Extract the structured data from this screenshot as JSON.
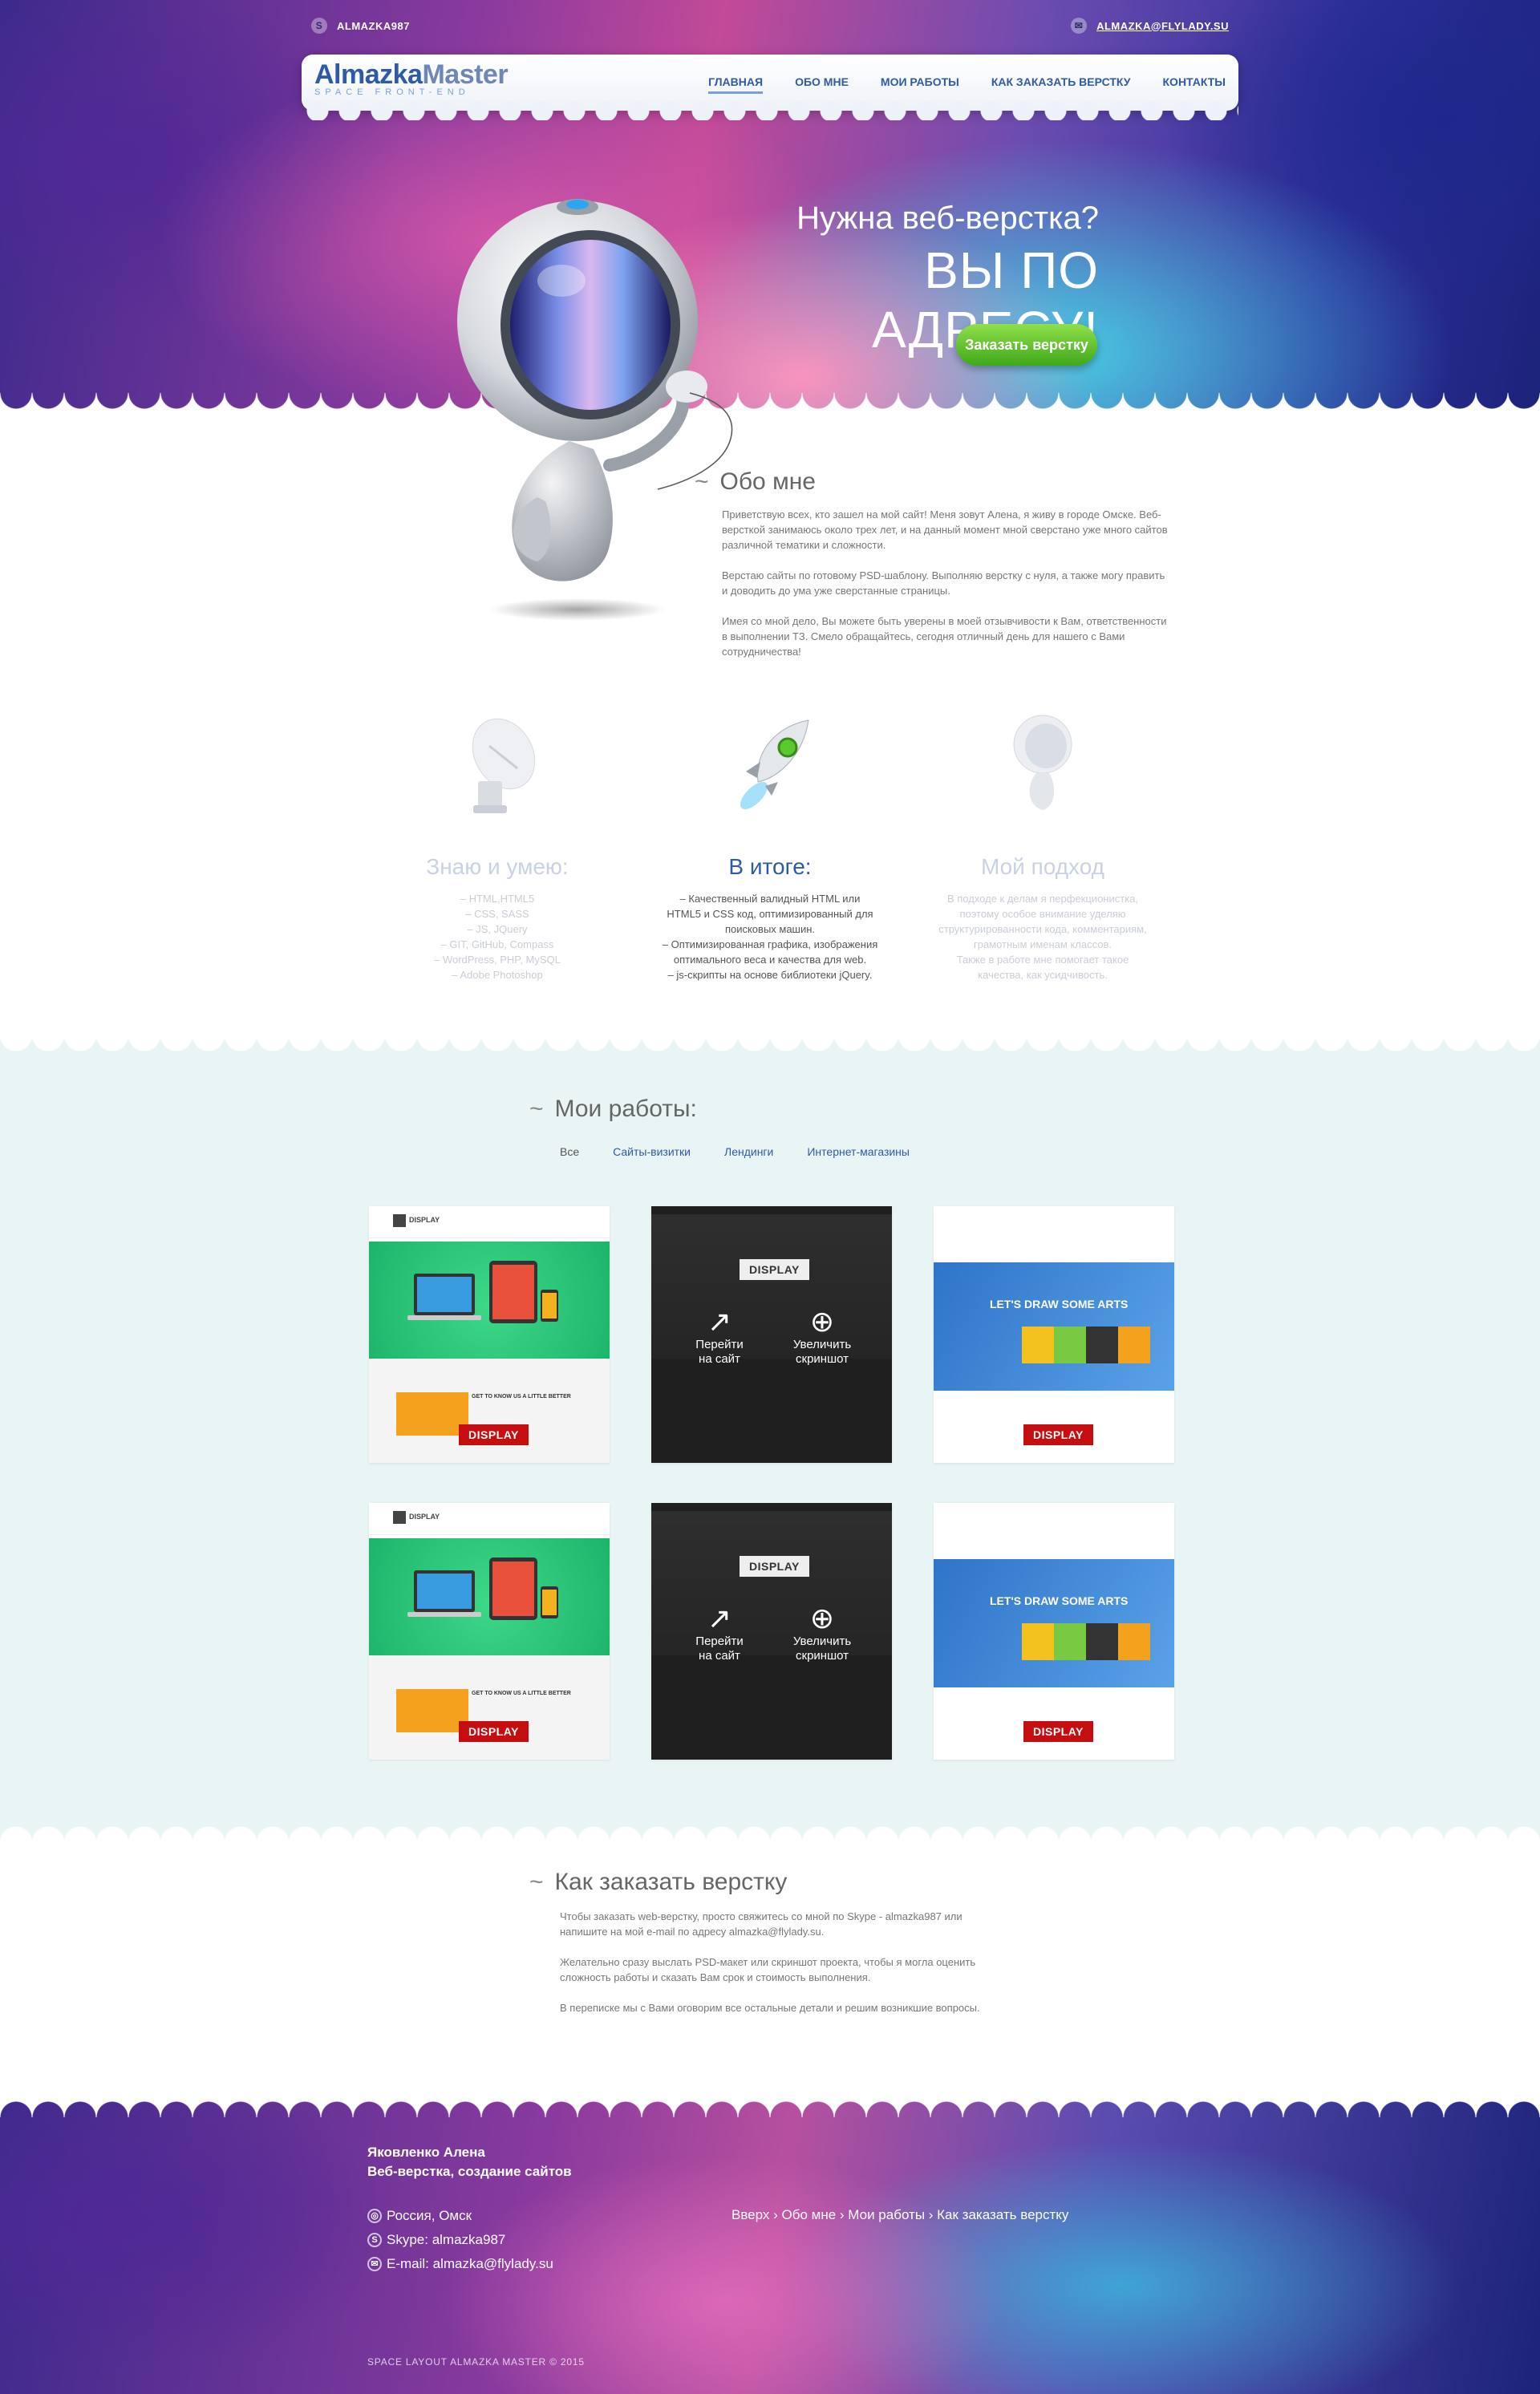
{
  "topbar": {
    "skype": "ALMAZKA987",
    "email": "ALMAZKA@FLYLADY.SU"
  },
  "logo": {
    "part1": "Almazka",
    "part2": "Master",
    "tagline": "SPACE FRONT-END"
  },
  "nav": [
    "ГЛАВНАЯ",
    "ОБО МНЕ",
    "МОИ РАБОТЫ",
    "КАК ЗАКАЗАТЬ ВЕРСТКУ",
    "КОНТАКТЫ"
  ],
  "hero": {
    "line1": "Нужна веб-верстка?",
    "line2": "ВЫ ПО АДРЕСУ!",
    "button": "Заказать верстку"
  },
  "about": {
    "title": "Обо мне",
    "paragraphs": [
      "Приветствую всех, кто зашел на мой сайт! Меня зовут Алена, я живу в городе Омске. Веб-версткой занимаюсь около трех лет, и на данный момент мной сверстано уже много сайтов различной тематики и сложности.",
      "Верстаю сайты по готовому PSD-шаблону. Выполняю верстку с нуля, а также могу править и доводить до ума уже сверстанные страницы.",
      "Имея со мной дело, Вы можете быть уверены в моей отзывчивости к Вам, ответственности в выполнении ТЗ. Смело обращайтесь, сегодня отличный день для нашего с Вами сотрудничества!"
    ]
  },
  "features": [
    {
      "title": "Знаю и умею:",
      "lines": [
        "– HTML,HTML5",
        "– CSS, SASS",
        "– JS, JQuery",
        "– GIT, GitHub, Compass",
        "– WordPress, PHP, MySQL",
        "– Adobe Photoshop"
      ]
    },
    {
      "title": "В итоге:",
      "lines": [
        "– Качественный валидный HTML или",
        "HTML5 и CSS код, оптимизированный для",
        "поисковых машин.",
        "– Оптимизированная графика, изображения",
        "оптимального веса и качества для web.",
        "– js-скрипты на основе библиотеки jQuery."
      ]
    },
    {
      "title": "Мой подход",
      "lines": [
        "В подходе к делам я перфекционистка,",
        "поэтому особое внимание уделяю",
        "структурированности кода, комментариям,",
        "грамотным именам классов.",
        "Также в работе мне помогает такое",
        "качества, как усидчивость."
      ]
    }
  ],
  "works": {
    "title": "Мои работы:",
    "filters": [
      "Все",
      "Сайты-визитки",
      "Лендинги",
      "Интернет-магазины"
    ],
    "badge": "DISPLAY",
    "goto": [
      "Перейти",
      "на сайт"
    ],
    "zoom": [
      "Увеличить",
      "скриншот"
    ],
    "blue_heading": "LET'S DRAW SOME ARTS",
    "green_tagline": "GET TO KNOW US A LITTLE BETTER"
  },
  "order": {
    "title": "Как заказать верстку",
    "paragraphs": [
      "Чтобы заказать web-верстку, просто свяжитесь со мной по Skype - almazka987 или напишите на мой e-mail по адресу almazka@flylady.su.",
      "Желательно сразу выслать PSD-макет или скриншот проекта, чтобы я могла оценить сложность работы и сказать Вам срок и стоимость выполнения.",
      "В переписке мы с Вами оговорим все остальные детали и решим возникшие вопросы."
    ]
  },
  "footer": {
    "name": "Яковленко Алена",
    "role": "Веб-верстка, создание сайтов",
    "location": "Россия, Омск",
    "skype": "Skype: almazka987",
    "email": "E-mail: almazka@flylady.su",
    "nav": "Вверх › Обо мне › Мои работы › Как заказать верстку",
    "copyright": "SPACE LAYOUT ALMAZKA MASTER © 2015"
  }
}
